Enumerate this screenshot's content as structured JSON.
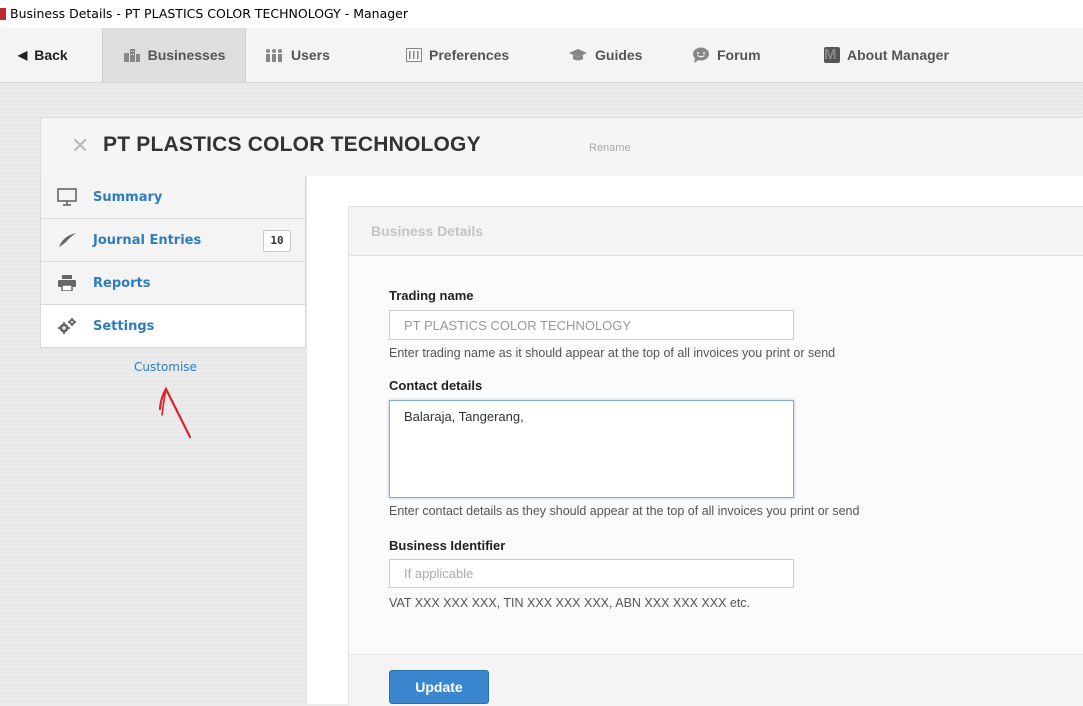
{
  "window": {
    "title": "Business Details - PT PLASTICS COLOR TECHNOLOGY - Manager"
  },
  "nav": {
    "back": "Back",
    "businesses": "Businesses",
    "users": "Users",
    "preferences": "Preferences",
    "guides": "Guides",
    "forum": "Forum",
    "about": "About Manager",
    "about_icon_letter": "M",
    "active": "Businesses"
  },
  "business": {
    "name": "PT PLASTICS COLOR TECHNOLOGY",
    "rename": "Rename"
  },
  "sidebar": {
    "items": [
      {
        "label": "Summary",
        "icon": "presentation-icon"
      },
      {
        "label": "Journal Entries",
        "icon": "quill-icon",
        "badge": "10"
      },
      {
        "label": "Reports",
        "icon": "printer-icon"
      },
      {
        "label": "Settings",
        "icon": "gears-icon",
        "active": true
      }
    ],
    "customise": "Customise"
  },
  "panel": {
    "title": "Business Details",
    "trading_name": {
      "label": "Trading name",
      "value": "PT PLASTICS COLOR TECHNOLOGY",
      "help": "Enter trading name as it should appear at the top of all invoices you print or send"
    },
    "contact_details": {
      "label": "Contact details",
      "value": "Balaraja, Tangerang,",
      "help": "Enter contact details as they should appear at the top of all invoices you print or send"
    },
    "business_identifier": {
      "label": "Business Identifier",
      "placeholder": "If applicable",
      "value": "",
      "help": "VAT XXX XXX XXX, TIN XXX XXX XXX, ABN XXX XXX XXX etc."
    },
    "update": "Update"
  },
  "colors": {
    "accent": "#3a87cf",
    "link": "#2f7cc1",
    "annotation": "#d9232d"
  }
}
